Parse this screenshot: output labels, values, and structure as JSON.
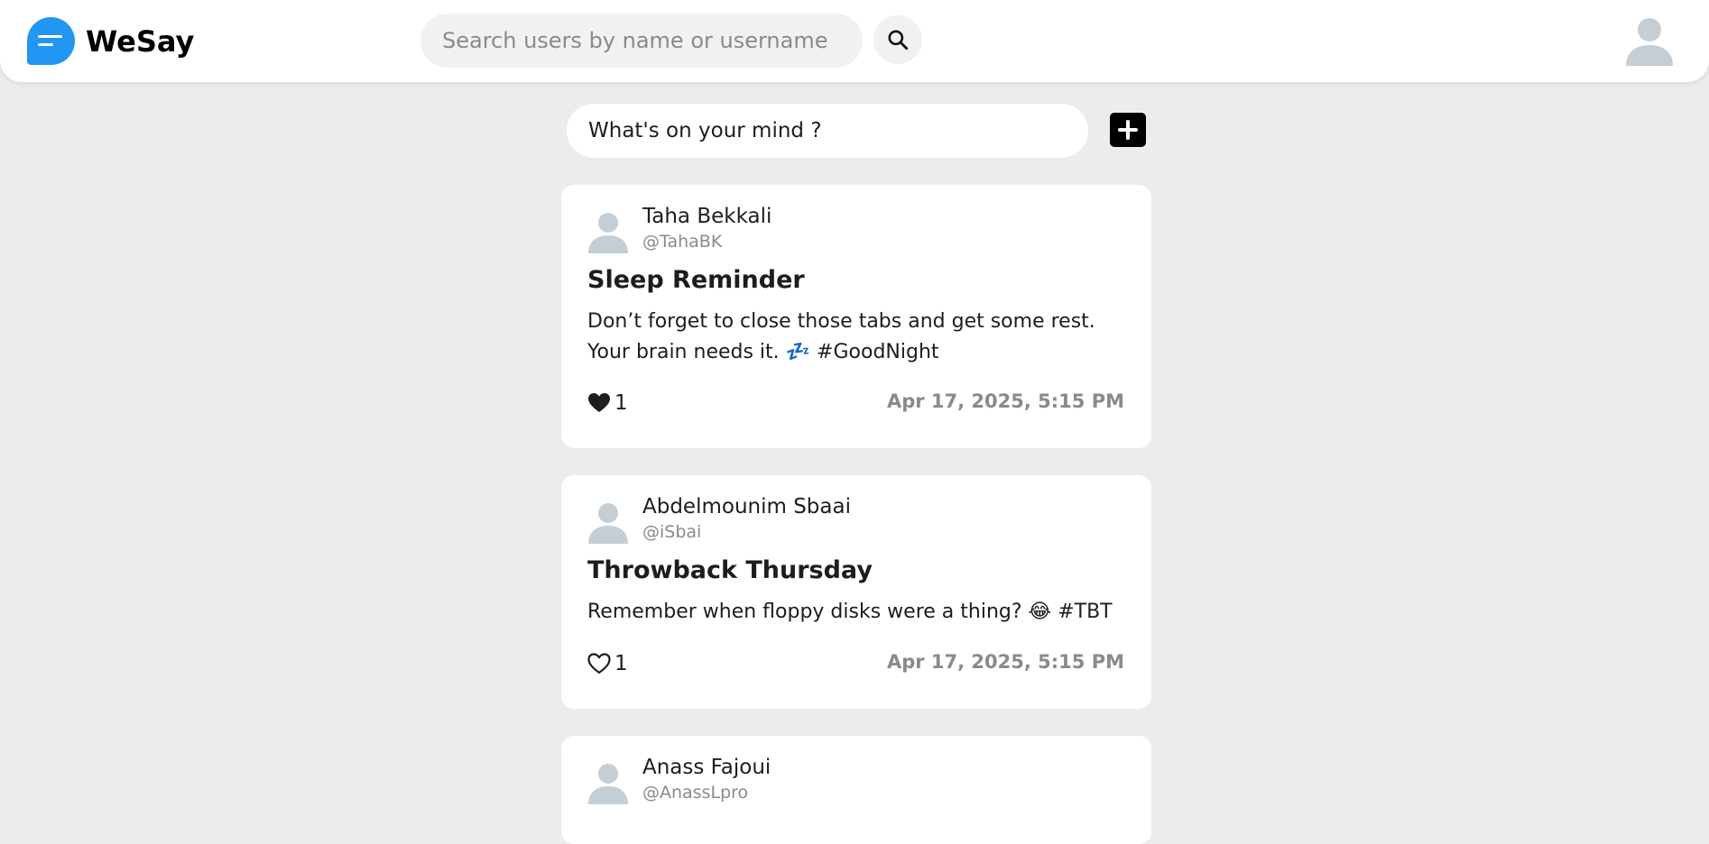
{
  "app": {
    "name": "WeSay",
    "accent_color": "#2196f3"
  },
  "header": {
    "search_placeholder": "Search users by name or username",
    "search_icon": "search-icon",
    "avatar_icon": "user-avatar-icon"
  },
  "composer": {
    "placeholder": "What's on your mind ?",
    "add_icon": "plus-icon"
  },
  "posts": [
    {
      "author": "Taha Bekkali",
      "handle": "@TahaBK",
      "title": "Sleep Reminder",
      "body_line1": "Don’t forget to close those tabs and get some rest.",
      "body_line2": "Your brain needs it. 💤 #GoodNight",
      "likes": "1",
      "liked": true,
      "time": "Apr 17, 2025, 5:15 PM"
    },
    {
      "author": "Abdelmounim Sbaai",
      "handle": "@iSbai",
      "title": "Throwback Thursday",
      "body_line1": "Remember when floppy disks were a thing? 😂 #TBT",
      "likes": "1",
      "liked": false,
      "time": "Apr 17, 2025, 5:15 PM"
    },
    {
      "author": "Anass Fajoui",
      "handle": "@AnassLpro"
    }
  ]
}
